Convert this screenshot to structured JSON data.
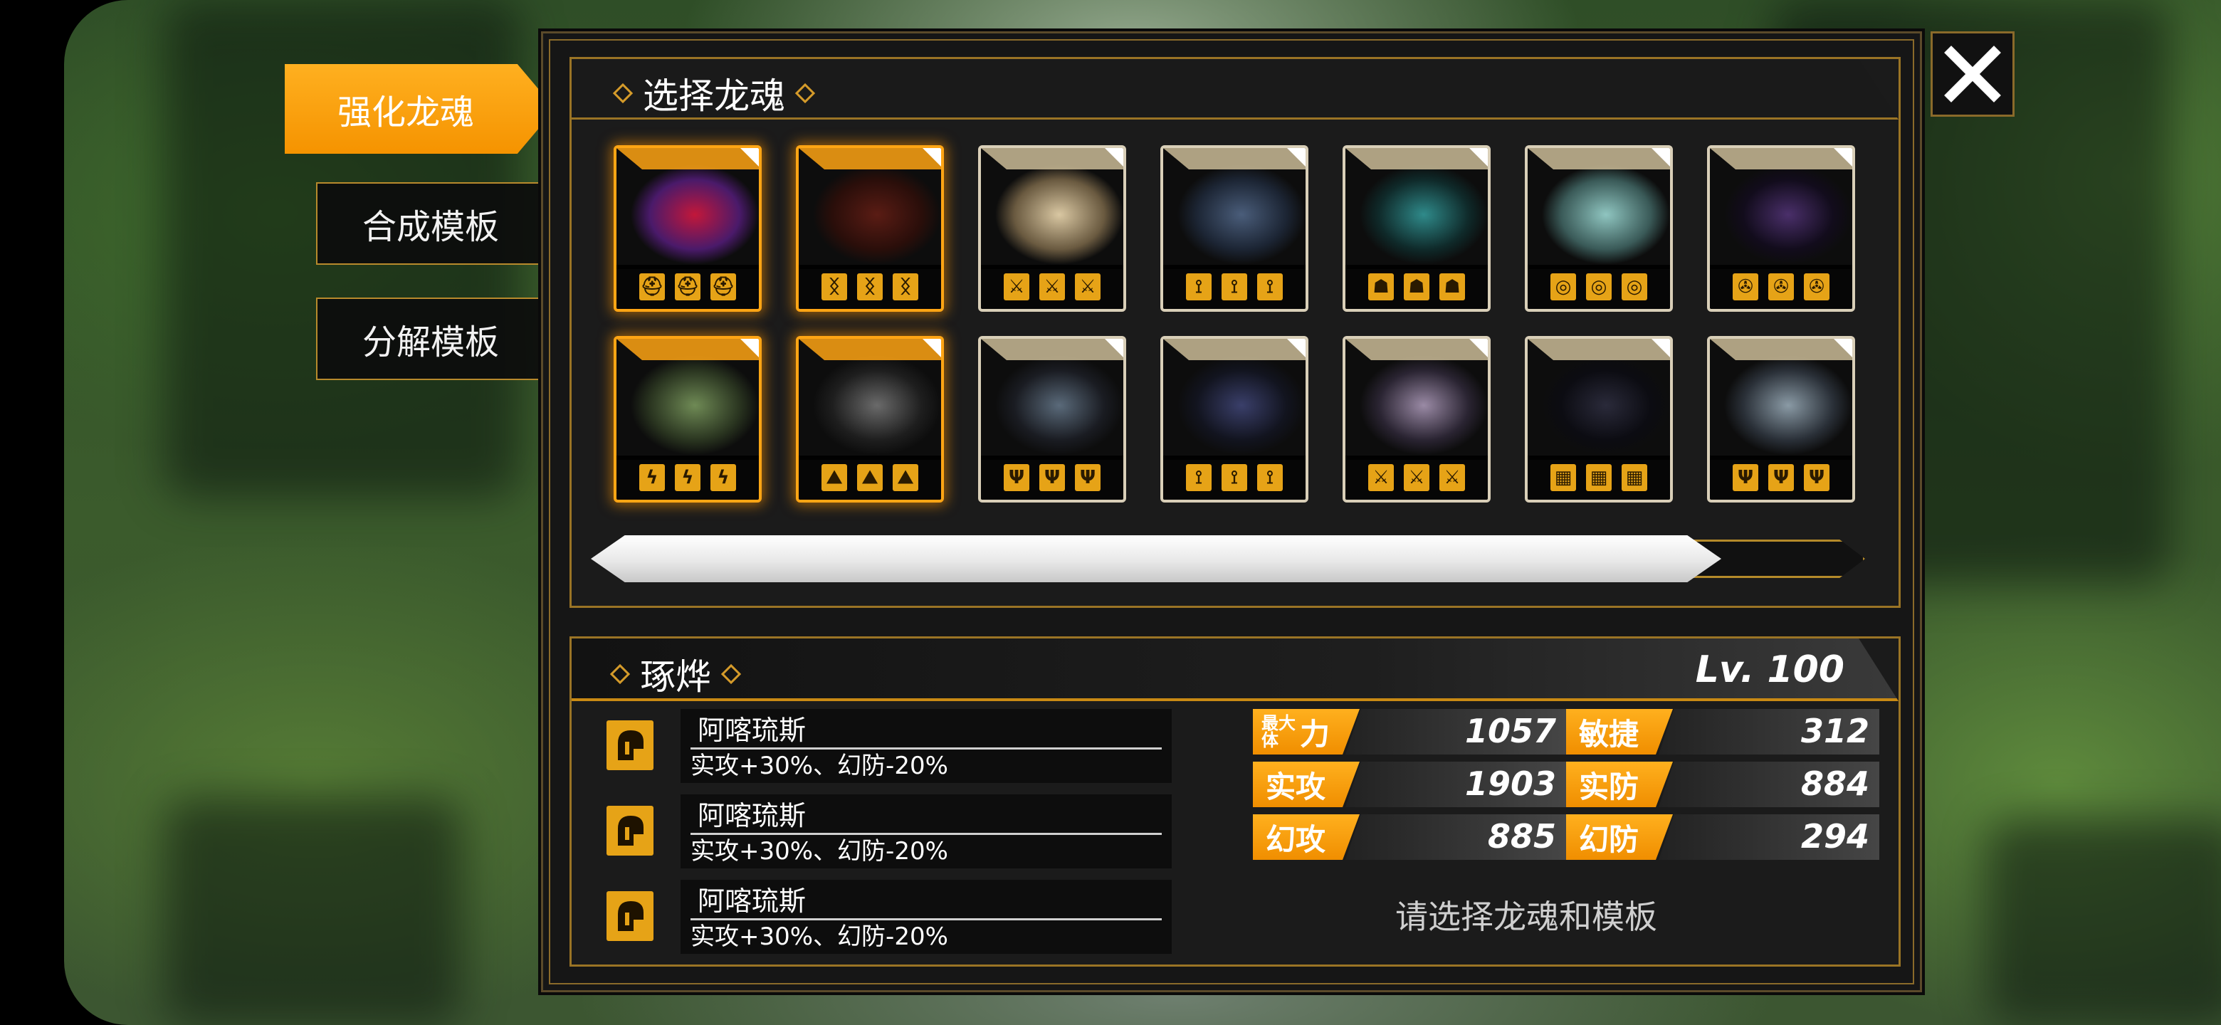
{
  "tabs": [
    {
      "label": "强化龙魂",
      "active": true
    },
    {
      "label": "合成模板",
      "active": false
    },
    {
      "label": "分解模板",
      "active": false
    }
  ],
  "close_icon": "close-icon",
  "select_section": {
    "title": "选择龙魂",
    "cards": [
      {
        "row": 1,
        "highlighted": true,
        "icon": "helmet-icon",
        "palette": [
          "#c2173a",
          "#4a1a6a"
        ]
      },
      {
        "row": 1,
        "highlighted": true,
        "icon": "rune-icon",
        "palette": [
          "#5a1c14",
          "#2a0e0a"
        ]
      },
      {
        "row": 1,
        "highlighted": false,
        "icon": "claw-icon",
        "palette": [
          "#d9c7a2",
          "#6a5a40"
        ]
      },
      {
        "row": 1,
        "highlighted": false,
        "icon": "totem-icon",
        "palette": [
          "#4a5d7a",
          "#1c2534"
        ]
      },
      {
        "row": 1,
        "highlighted": false,
        "icon": "mask-icon",
        "palette": [
          "#2f8a8a",
          "#0f2a2a"
        ]
      },
      {
        "row": 1,
        "highlighted": false,
        "icon": "orb-icon",
        "palette": [
          "#8fc5c0",
          "#3a5a58"
        ]
      },
      {
        "row": 1,
        "highlighted": false,
        "icon": "swirl-icon",
        "palette": [
          "#4a2f6a",
          "#120c1c"
        ]
      },
      {
        "row": 2,
        "highlighted": true,
        "icon": "wind-icon",
        "palette": [
          "#6f8a55",
          "#2a3520"
        ]
      },
      {
        "row": 2,
        "highlighted": true,
        "icon": "peak-icon",
        "palette": [
          "#6a6a6a",
          "#1e1e1e"
        ]
      },
      {
        "row": 2,
        "highlighted": false,
        "icon": "fork-icon",
        "palette": [
          "#5a6a7a",
          "#1a1c22"
        ]
      },
      {
        "row": 2,
        "highlighted": false,
        "icon": "totem-icon",
        "palette": [
          "#3a3f6a",
          "#12141f"
        ]
      },
      {
        "row": 2,
        "highlighted": false,
        "icon": "claw-icon",
        "palette": [
          "#9a8aa5",
          "#2a2432"
        ]
      },
      {
        "row": 2,
        "highlighted": false,
        "icon": "grid-icon",
        "palette": [
          "#2a2a3a",
          "#0c0c12"
        ]
      },
      {
        "row": 2,
        "highlighted": false,
        "icon": "fork-icon",
        "palette": [
          "#8a9aa5",
          "#2a3038"
        ]
      }
    ],
    "scroll_progress": 0.89
  },
  "detail": {
    "name": "琢烨",
    "level": "Lv. 100",
    "skills": [
      {
        "name": "阿喀琉斯",
        "desc": "实攻+30%、幻防-20%",
        "icon": "helmet-icon"
      },
      {
        "name": "阿喀琉斯",
        "desc": "实攻+30%、幻防-20%",
        "icon": "helmet-icon"
      },
      {
        "name": "阿喀琉斯",
        "desc": "实攻+30%、幻防-20%",
        "icon": "helmet-icon"
      }
    ],
    "stats": {
      "max_power": {
        "label_small": "最大体",
        "label": "力",
        "value": "1057"
      },
      "agility": {
        "label": "敏捷",
        "value": "312"
      },
      "phys_atk": {
        "label": "实攻",
        "value": "1903"
      },
      "phys_def": {
        "label": "实防",
        "value": "884"
      },
      "magic_atk": {
        "label": "幻攻",
        "value": "885"
      },
      "magic_def": {
        "label": "幻防",
        "value": "294"
      }
    },
    "hint": "请选择龙魂和模板"
  },
  "colors": {
    "accent": "#f59300",
    "frame": "#9a7425",
    "icon_gold": "#e6a317"
  }
}
